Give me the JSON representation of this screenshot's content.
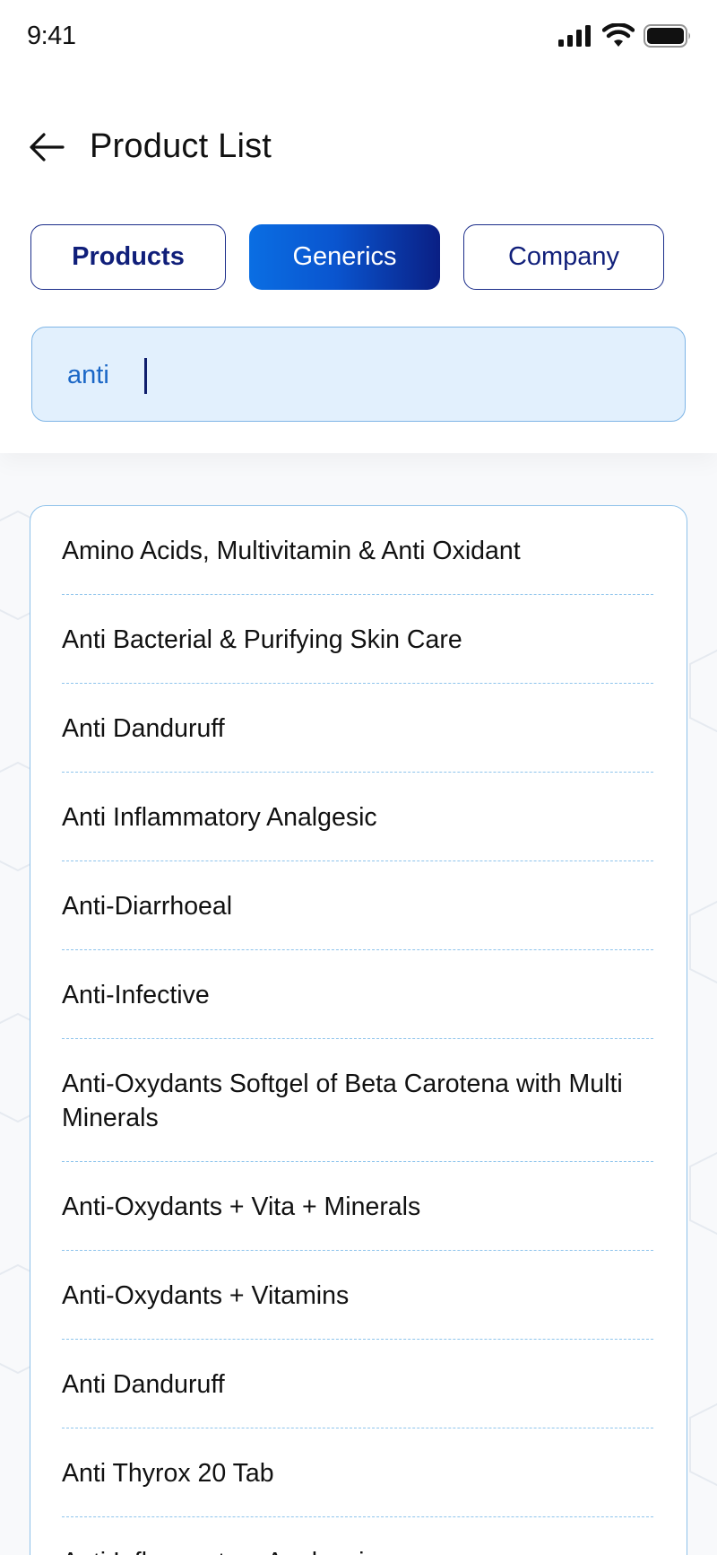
{
  "status_bar": {
    "time": "9:41",
    "icons": [
      "signal-icon",
      "wifi-icon",
      "battery-icon"
    ]
  },
  "header": {
    "back_icon": "arrow-left-icon",
    "title": "Product List"
  },
  "tabs": [
    {
      "label": "Products",
      "active": false
    },
    {
      "label": "Generics",
      "active": true
    },
    {
      "label": "Company",
      "active": false
    }
  ],
  "search": {
    "value": "anti",
    "placeholder": ""
  },
  "results": [
    "Amino Acids, Multivitamin & Anti Oxidant",
    "Anti Bacterial & Purifying Skin Care",
    "Anti Danduruff",
    "Anti Inflammatory Analgesic",
    "Anti-Diarrhoeal",
    "Anti-Infective",
    "Anti-Oxydants Softgel of Beta Carotena with Multi Minerals",
    "Anti-Oxydants + Vita + Minerals",
    "Anti-Oxydants + Vitamins",
    "Anti Danduruff",
    "Anti Thyrox 20 Tab",
    "Anti Inflammatory Analgesic"
  ],
  "colors": {
    "accent_start": "#0a6ee3",
    "accent_end": "#0a1f84",
    "tab_text": "#101f7a",
    "search_bg": "#e2f0fd",
    "search_text": "#1b67c6",
    "divider": "#8ec4ec"
  }
}
